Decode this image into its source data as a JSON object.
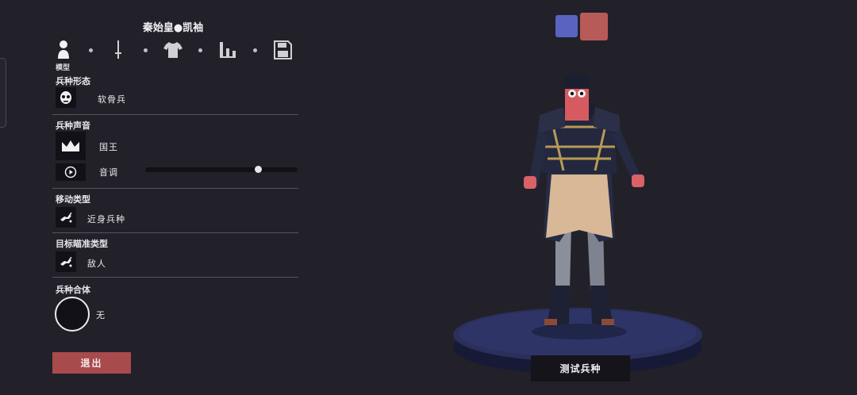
{
  "unit_name": "秦始皇●凯袖",
  "tabs": [
    {
      "icon": "person-icon"
    },
    {
      "icon": "sword-icon"
    },
    {
      "icon": "shirt-icon"
    },
    {
      "icon": "stats-icon"
    },
    {
      "icon": "save-icon"
    }
  ],
  "active_tab_label": "模型",
  "sections": {
    "unit_form": {
      "title": "兵种形态",
      "value": "软骨兵",
      "icon": "skull-mask-icon"
    },
    "unit_voice": {
      "title": "兵种声音",
      "value": "国王",
      "icon": "crown-icon",
      "pitch_label": "音调",
      "pitch_icon": "play-icon",
      "pitch_level": 0.74
    },
    "move_type": {
      "title": "移动类型",
      "value": "近身兵种",
      "icon": "melee-unit-icon"
    },
    "target_type": {
      "title": "目标瞄准类型",
      "value": "敌人",
      "icon": "target-enemy-icon"
    },
    "combine": {
      "title": "兵种合体",
      "value": "无"
    }
  },
  "exit_label": "退出",
  "test_label": "测试兵种",
  "team_colors": [
    "#5a63c0",
    "#b85a58"
  ],
  "colors": {
    "accent": "#a94a4d",
    "background": "#222129",
    "panel": "#121117"
  }
}
